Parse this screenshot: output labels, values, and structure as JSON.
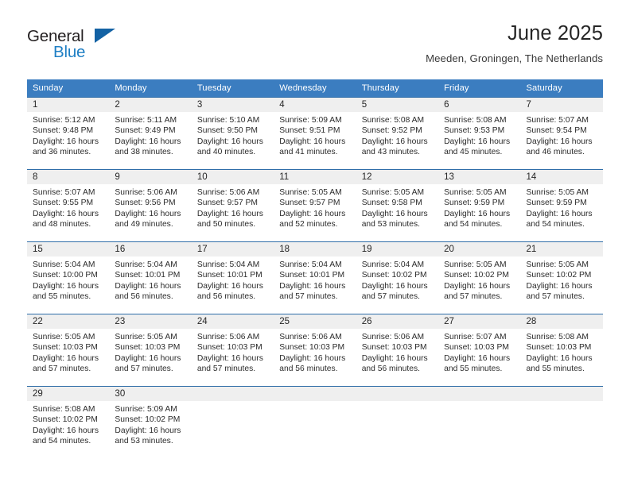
{
  "logo": {
    "text_primary": "General",
    "text_secondary": "Blue",
    "accent_color": "#1362a4"
  },
  "header": {
    "title": "June 2025",
    "subtitle": "Meeden, Groningen, The Netherlands"
  },
  "theme": {
    "header_row_bg": "#3b7dc0",
    "cell_border": "#2e6da8",
    "daynum_bg": "#efefef"
  },
  "calendar": {
    "weekday_headers": [
      "Sunday",
      "Monday",
      "Tuesday",
      "Wednesday",
      "Thursday",
      "Friday",
      "Saturday"
    ],
    "weeks": [
      [
        {
          "day": "1",
          "sunrise": "Sunrise: 5:12 AM",
          "sunset": "Sunset: 9:48 PM",
          "daylight_line1": "Daylight: 16 hours",
          "daylight_line2": "and 36 minutes."
        },
        {
          "day": "2",
          "sunrise": "Sunrise: 5:11 AM",
          "sunset": "Sunset: 9:49 PM",
          "daylight_line1": "Daylight: 16 hours",
          "daylight_line2": "and 38 minutes."
        },
        {
          "day": "3",
          "sunrise": "Sunrise: 5:10 AM",
          "sunset": "Sunset: 9:50 PM",
          "daylight_line1": "Daylight: 16 hours",
          "daylight_line2": "and 40 minutes."
        },
        {
          "day": "4",
          "sunrise": "Sunrise: 5:09 AM",
          "sunset": "Sunset: 9:51 PM",
          "daylight_line1": "Daylight: 16 hours",
          "daylight_line2": "and 41 minutes."
        },
        {
          "day": "5",
          "sunrise": "Sunrise: 5:08 AM",
          "sunset": "Sunset: 9:52 PM",
          "daylight_line1": "Daylight: 16 hours",
          "daylight_line2": "and 43 minutes."
        },
        {
          "day": "6",
          "sunrise": "Sunrise: 5:08 AM",
          "sunset": "Sunset: 9:53 PM",
          "daylight_line1": "Daylight: 16 hours",
          "daylight_line2": "and 45 minutes."
        },
        {
          "day": "7",
          "sunrise": "Sunrise: 5:07 AM",
          "sunset": "Sunset: 9:54 PM",
          "daylight_line1": "Daylight: 16 hours",
          "daylight_line2": "and 46 minutes."
        }
      ],
      [
        {
          "day": "8",
          "sunrise": "Sunrise: 5:07 AM",
          "sunset": "Sunset: 9:55 PM",
          "daylight_line1": "Daylight: 16 hours",
          "daylight_line2": "and 48 minutes."
        },
        {
          "day": "9",
          "sunrise": "Sunrise: 5:06 AM",
          "sunset": "Sunset: 9:56 PM",
          "daylight_line1": "Daylight: 16 hours",
          "daylight_line2": "and 49 minutes."
        },
        {
          "day": "10",
          "sunrise": "Sunrise: 5:06 AM",
          "sunset": "Sunset: 9:57 PM",
          "daylight_line1": "Daylight: 16 hours",
          "daylight_line2": "and 50 minutes."
        },
        {
          "day": "11",
          "sunrise": "Sunrise: 5:05 AM",
          "sunset": "Sunset: 9:57 PM",
          "daylight_line1": "Daylight: 16 hours",
          "daylight_line2": "and 52 minutes."
        },
        {
          "day": "12",
          "sunrise": "Sunrise: 5:05 AM",
          "sunset": "Sunset: 9:58 PM",
          "daylight_line1": "Daylight: 16 hours",
          "daylight_line2": "and 53 minutes."
        },
        {
          "day": "13",
          "sunrise": "Sunrise: 5:05 AM",
          "sunset": "Sunset: 9:59 PM",
          "daylight_line1": "Daylight: 16 hours",
          "daylight_line2": "and 54 minutes."
        },
        {
          "day": "14",
          "sunrise": "Sunrise: 5:05 AM",
          "sunset": "Sunset: 9:59 PM",
          "daylight_line1": "Daylight: 16 hours",
          "daylight_line2": "and 54 minutes."
        }
      ],
      [
        {
          "day": "15",
          "sunrise": "Sunrise: 5:04 AM",
          "sunset": "Sunset: 10:00 PM",
          "daylight_line1": "Daylight: 16 hours",
          "daylight_line2": "and 55 minutes."
        },
        {
          "day": "16",
          "sunrise": "Sunrise: 5:04 AM",
          "sunset": "Sunset: 10:01 PM",
          "daylight_line1": "Daylight: 16 hours",
          "daylight_line2": "and 56 minutes."
        },
        {
          "day": "17",
          "sunrise": "Sunrise: 5:04 AM",
          "sunset": "Sunset: 10:01 PM",
          "daylight_line1": "Daylight: 16 hours",
          "daylight_line2": "and 56 minutes."
        },
        {
          "day": "18",
          "sunrise": "Sunrise: 5:04 AM",
          "sunset": "Sunset: 10:01 PM",
          "daylight_line1": "Daylight: 16 hours",
          "daylight_line2": "and 57 minutes."
        },
        {
          "day": "19",
          "sunrise": "Sunrise: 5:04 AM",
          "sunset": "Sunset: 10:02 PM",
          "daylight_line1": "Daylight: 16 hours",
          "daylight_line2": "and 57 minutes."
        },
        {
          "day": "20",
          "sunrise": "Sunrise: 5:05 AM",
          "sunset": "Sunset: 10:02 PM",
          "daylight_line1": "Daylight: 16 hours",
          "daylight_line2": "and 57 minutes."
        },
        {
          "day": "21",
          "sunrise": "Sunrise: 5:05 AM",
          "sunset": "Sunset: 10:02 PM",
          "daylight_line1": "Daylight: 16 hours",
          "daylight_line2": "and 57 minutes."
        }
      ],
      [
        {
          "day": "22",
          "sunrise": "Sunrise: 5:05 AM",
          "sunset": "Sunset: 10:03 PM",
          "daylight_line1": "Daylight: 16 hours",
          "daylight_line2": "and 57 minutes."
        },
        {
          "day": "23",
          "sunrise": "Sunrise: 5:05 AM",
          "sunset": "Sunset: 10:03 PM",
          "daylight_line1": "Daylight: 16 hours",
          "daylight_line2": "and 57 minutes."
        },
        {
          "day": "24",
          "sunrise": "Sunrise: 5:06 AM",
          "sunset": "Sunset: 10:03 PM",
          "daylight_line1": "Daylight: 16 hours",
          "daylight_line2": "and 57 minutes."
        },
        {
          "day": "25",
          "sunrise": "Sunrise: 5:06 AM",
          "sunset": "Sunset: 10:03 PM",
          "daylight_line1": "Daylight: 16 hours",
          "daylight_line2": "and 56 minutes."
        },
        {
          "day": "26",
          "sunrise": "Sunrise: 5:06 AM",
          "sunset": "Sunset: 10:03 PM",
          "daylight_line1": "Daylight: 16 hours",
          "daylight_line2": "and 56 minutes."
        },
        {
          "day": "27",
          "sunrise": "Sunrise: 5:07 AM",
          "sunset": "Sunset: 10:03 PM",
          "daylight_line1": "Daylight: 16 hours",
          "daylight_line2": "and 55 minutes."
        },
        {
          "day": "28",
          "sunrise": "Sunrise: 5:08 AM",
          "sunset": "Sunset: 10:03 PM",
          "daylight_line1": "Daylight: 16 hours",
          "daylight_line2": "and 55 minutes."
        }
      ],
      [
        {
          "day": "29",
          "sunrise": "Sunrise: 5:08 AM",
          "sunset": "Sunset: 10:02 PM",
          "daylight_line1": "Daylight: 16 hours",
          "daylight_line2": "and 54 minutes."
        },
        {
          "day": "30",
          "sunrise": "Sunrise: 5:09 AM",
          "sunset": "Sunset: 10:02 PM",
          "daylight_line1": "Daylight: 16 hours",
          "daylight_line2": "and 53 minutes."
        },
        {
          "day": "",
          "sunrise": "",
          "sunset": "",
          "daylight_line1": "",
          "daylight_line2": ""
        },
        {
          "day": "",
          "sunrise": "",
          "sunset": "",
          "daylight_line1": "",
          "daylight_line2": ""
        },
        {
          "day": "",
          "sunrise": "",
          "sunset": "",
          "daylight_line1": "",
          "daylight_line2": ""
        },
        {
          "day": "",
          "sunrise": "",
          "sunset": "",
          "daylight_line1": "",
          "daylight_line2": ""
        },
        {
          "day": "",
          "sunrise": "",
          "sunset": "",
          "daylight_line1": "",
          "daylight_line2": ""
        }
      ]
    ]
  }
}
